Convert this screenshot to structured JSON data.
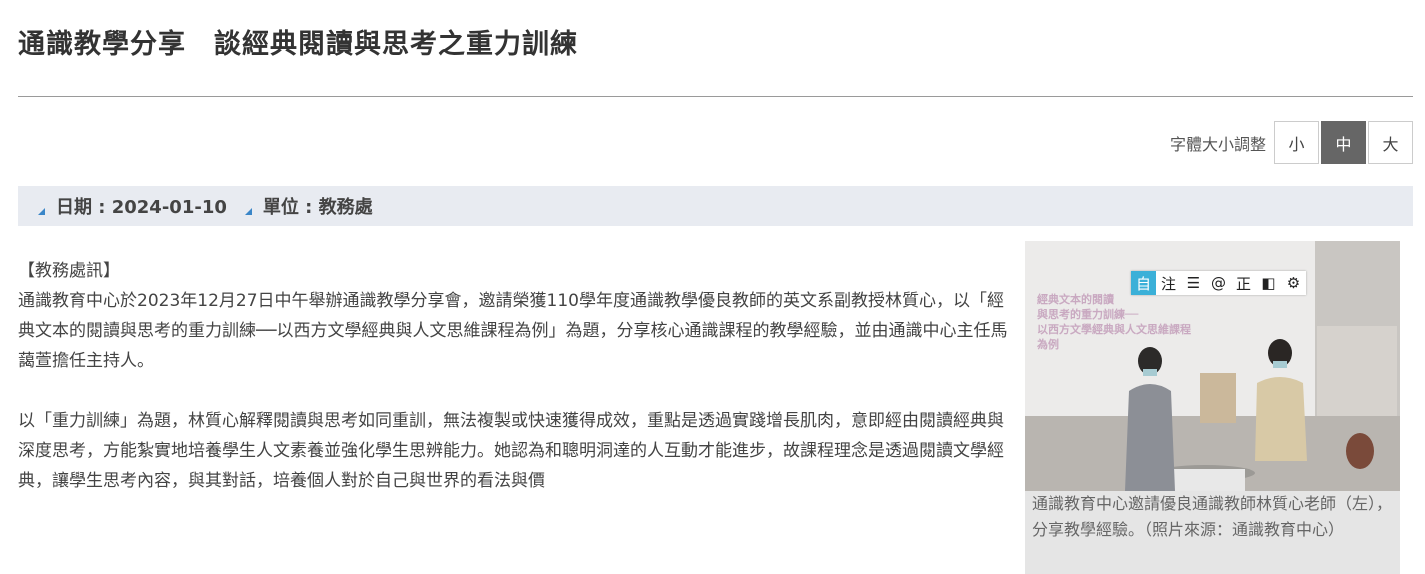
{
  "header": {
    "title": "通識教學分享　談經典閱讀與思考之重力訓練"
  },
  "font_size_control": {
    "label": "字體大小調整",
    "options": [
      "小",
      "中",
      "大"
    ],
    "selected": "中"
  },
  "meta": {
    "date": "日期 : 2024-01-10",
    "unit": "單位 : 教務處"
  },
  "article": {
    "paragraphs": [
      "【教務處訊】",
      "通識教育中心於2023年12月27日中午舉辦通識教學分享會，邀請榮獲110學年度通識教學優良教師的英文系副教授林質心，以「經典文本的閱讀與思考的重力訓練──以西方文學經典與人文思維課程為例」為題，分享核心通識課程的教學經驗，並由通識中心主任馬藹萱擔任主持人。",
      "以「重力訓練」為題，林質心解釋閱讀與思考如同重訓，無法複製或快速獲得成效，重點是透過實踐增長肌肉，意即經由閱讀經典與深度思考，方能紮實地培養學生人文素養並強化學生思辨能力。她認為和聰明洞達的人互動才能進步，故課程理念是透過閱讀文學經典，讓學生思考內容，與其對話，培養個人對於自己與世界的看法與價"
    ]
  },
  "figure": {
    "slide_text": [
      "經典文本的閱讀",
      "與思考的重力訓練──",
      "以西方文學經典與人文思維課程",
      "為例"
    ],
    "caption": "通識教育中心邀請優良通識教師林質心老師（左），分享教學經驗。（照片來源：通識教育中心）",
    "toolbar": [
      {
        "label": "自",
        "icon": "auto-icon",
        "active": true
      },
      {
        "label": "注",
        "icon": "annotate-icon",
        "active": false
      },
      {
        "label": "☰",
        "icon": "list-icon",
        "active": false
      },
      {
        "label": "@",
        "icon": "at-icon",
        "active": false
      },
      {
        "label": "正",
        "icon": "correct-icon",
        "active": false
      },
      {
        "label": "◧",
        "icon": "contrast-icon",
        "active": false
      },
      {
        "label": "⚙",
        "icon": "gear-icon",
        "active": false
      }
    ]
  },
  "colors": {
    "meta_bg": "#e8ebf1",
    "meta_marker": "#3a86c8",
    "active_font_btn": "#666666",
    "toolbar_active": "#3bb0d8"
  }
}
